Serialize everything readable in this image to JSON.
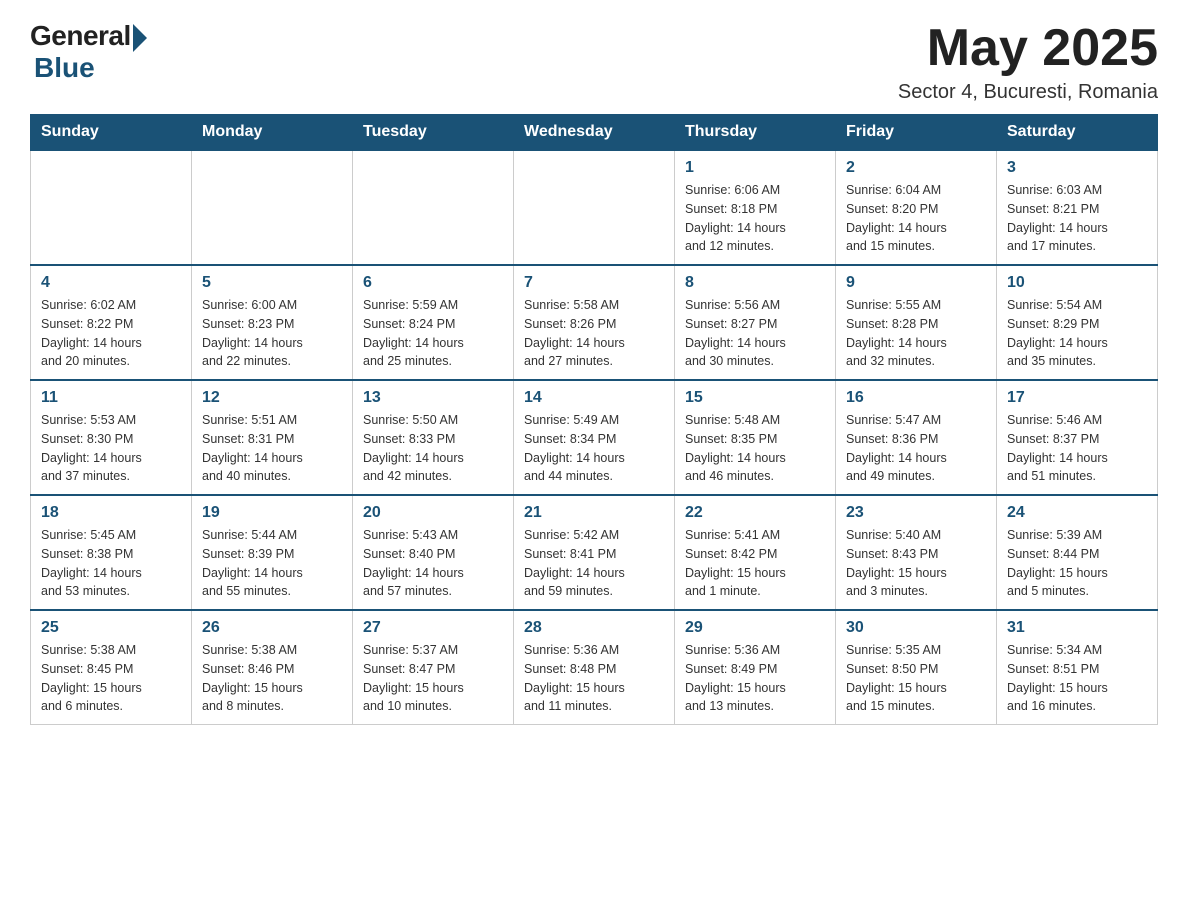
{
  "header": {
    "logo_general": "General",
    "logo_blue": "Blue",
    "month_year": "May 2025",
    "location": "Sector 4, Bucuresti, Romania"
  },
  "weekdays": [
    "Sunday",
    "Monday",
    "Tuesday",
    "Wednesday",
    "Thursday",
    "Friday",
    "Saturday"
  ],
  "weeks": [
    [
      {
        "day": "",
        "info": ""
      },
      {
        "day": "",
        "info": ""
      },
      {
        "day": "",
        "info": ""
      },
      {
        "day": "",
        "info": ""
      },
      {
        "day": "1",
        "info": "Sunrise: 6:06 AM\nSunset: 8:18 PM\nDaylight: 14 hours\nand 12 minutes."
      },
      {
        "day": "2",
        "info": "Sunrise: 6:04 AM\nSunset: 8:20 PM\nDaylight: 14 hours\nand 15 minutes."
      },
      {
        "day": "3",
        "info": "Sunrise: 6:03 AM\nSunset: 8:21 PM\nDaylight: 14 hours\nand 17 minutes."
      }
    ],
    [
      {
        "day": "4",
        "info": "Sunrise: 6:02 AM\nSunset: 8:22 PM\nDaylight: 14 hours\nand 20 minutes."
      },
      {
        "day": "5",
        "info": "Sunrise: 6:00 AM\nSunset: 8:23 PM\nDaylight: 14 hours\nand 22 minutes."
      },
      {
        "day": "6",
        "info": "Sunrise: 5:59 AM\nSunset: 8:24 PM\nDaylight: 14 hours\nand 25 minutes."
      },
      {
        "day": "7",
        "info": "Sunrise: 5:58 AM\nSunset: 8:26 PM\nDaylight: 14 hours\nand 27 minutes."
      },
      {
        "day": "8",
        "info": "Sunrise: 5:56 AM\nSunset: 8:27 PM\nDaylight: 14 hours\nand 30 minutes."
      },
      {
        "day": "9",
        "info": "Sunrise: 5:55 AM\nSunset: 8:28 PM\nDaylight: 14 hours\nand 32 minutes."
      },
      {
        "day": "10",
        "info": "Sunrise: 5:54 AM\nSunset: 8:29 PM\nDaylight: 14 hours\nand 35 minutes."
      }
    ],
    [
      {
        "day": "11",
        "info": "Sunrise: 5:53 AM\nSunset: 8:30 PM\nDaylight: 14 hours\nand 37 minutes."
      },
      {
        "day": "12",
        "info": "Sunrise: 5:51 AM\nSunset: 8:31 PM\nDaylight: 14 hours\nand 40 minutes."
      },
      {
        "day": "13",
        "info": "Sunrise: 5:50 AM\nSunset: 8:33 PM\nDaylight: 14 hours\nand 42 minutes."
      },
      {
        "day": "14",
        "info": "Sunrise: 5:49 AM\nSunset: 8:34 PM\nDaylight: 14 hours\nand 44 minutes."
      },
      {
        "day": "15",
        "info": "Sunrise: 5:48 AM\nSunset: 8:35 PM\nDaylight: 14 hours\nand 46 minutes."
      },
      {
        "day": "16",
        "info": "Sunrise: 5:47 AM\nSunset: 8:36 PM\nDaylight: 14 hours\nand 49 minutes."
      },
      {
        "day": "17",
        "info": "Sunrise: 5:46 AM\nSunset: 8:37 PM\nDaylight: 14 hours\nand 51 minutes."
      }
    ],
    [
      {
        "day": "18",
        "info": "Sunrise: 5:45 AM\nSunset: 8:38 PM\nDaylight: 14 hours\nand 53 minutes."
      },
      {
        "day": "19",
        "info": "Sunrise: 5:44 AM\nSunset: 8:39 PM\nDaylight: 14 hours\nand 55 minutes."
      },
      {
        "day": "20",
        "info": "Sunrise: 5:43 AM\nSunset: 8:40 PM\nDaylight: 14 hours\nand 57 minutes."
      },
      {
        "day": "21",
        "info": "Sunrise: 5:42 AM\nSunset: 8:41 PM\nDaylight: 14 hours\nand 59 minutes."
      },
      {
        "day": "22",
        "info": "Sunrise: 5:41 AM\nSunset: 8:42 PM\nDaylight: 15 hours\nand 1 minute."
      },
      {
        "day": "23",
        "info": "Sunrise: 5:40 AM\nSunset: 8:43 PM\nDaylight: 15 hours\nand 3 minutes."
      },
      {
        "day": "24",
        "info": "Sunrise: 5:39 AM\nSunset: 8:44 PM\nDaylight: 15 hours\nand 5 minutes."
      }
    ],
    [
      {
        "day": "25",
        "info": "Sunrise: 5:38 AM\nSunset: 8:45 PM\nDaylight: 15 hours\nand 6 minutes."
      },
      {
        "day": "26",
        "info": "Sunrise: 5:38 AM\nSunset: 8:46 PM\nDaylight: 15 hours\nand 8 minutes."
      },
      {
        "day": "27",
        "info": "Sunrise: 5:37 AM\nSunset: 8:47 PM\nDaylight: 15 hours\nand 10 minutes."
      },
      {
        "day": "28",
        "info": "Sunrise: 5:36 AM\nSunset: 8:48 PM\nDaylight: 15 hours\nand 11 minutes."
      },
      {
        "day": "29",
        "info": "Sunrise: 5:36 AM\nSunset: 8:49 PM\nDaylight: 15 hours\nand 13 minutes."
      },
      {
        "day": "30",
        "info": "Sunrise: 5:35 AM\nSunset: 8:50 PM\nDaylight: 15 hours\nand 15 minutes."
      },
      {
        "day": "31",
        "info": "Sunrise: 5:34 AM\nSunset: 8:51 PM\nDaylight: 15 hours\nand 16 minutes."
      }
    ]
  ]
}
